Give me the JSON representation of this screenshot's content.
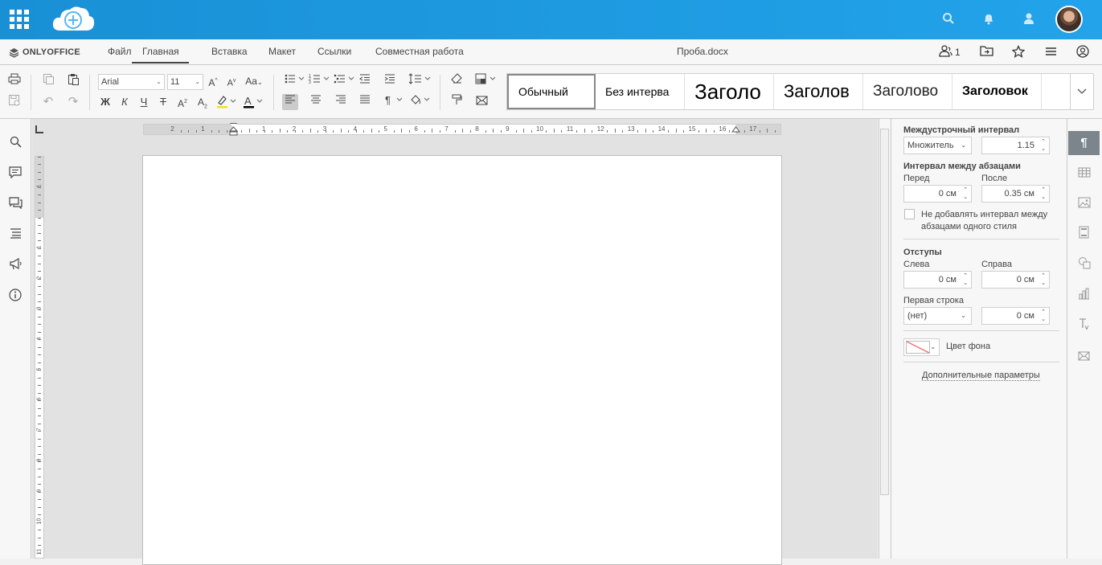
{
  "topbar": {
    "icons": [
      "apps-grid-icon",
      "cloud-logo",
      "search-icon",
      "bell-icon",
      "user-icon",
      "avatar"
    ]
  },
  "menubar": {
    "brand": "ONLYOFFICE",
    "tabs": [
      "Файл",
      "Главная",
      "Вставка",
      "Макет",
      "Ссылки",
      "Совместная работа"
    ],
    "active_tab": "Главная",
    "doc_title": "Проба.docx",
    "users_count": "1"
  },
  "toolbar": {
    "font_name": "Arial",
    "font_size": "11",
    "styles": [
      "Обычный",
      "Без интерва",
      "Заголо",
      "Заголов",
      "Заголово",
      "Заголовок"
    ]
  },
  "ruler": {
    "h_numbers": [
      "2",
      "1",
      "1",
      "2",
      "3",
      "4",
      "5",
      "6",
      "7",
      "8",
      "9",
      "10",
      "11",
      "12",
      "13",
      "14",
      "15",
      "16",
      "17"
    ],
    "v_numbers": [
      "1",
      "1",
      "2",
      "3",
      "4",
      "5",
      "6",
      "7",
      "8",
      "9",
      "10",
      "11"
    ]
  },
  "right_panel": {
    "line_spacing_label": "Междустрочный интервал",
    "line_spacing_mode": "Множитель",
    "line_spacing_value": "1.15",
    "para_spacing_label": "Интервал между абзацами",
    "before_label": "Перед",
    "after_label": "После",
    "before_value": "0 см",
    "after_value": "0.35 см",
    "no_spacing_label_1": "Не добавлять интервал между",
    "no_spacing_label_2": "абзацами одного стиля",
    "indents_label": "Отступы",
    "left_label": "Слева",
    "right_label": "Справа",
    "left_value": "0 см",
    "right_value": "0 см",
    "first_line_label": "Первая строка",
    "first_line_mode": "(нет)",
    "first_line_value": "0 см",
    "bg_color_label": "Цвет фона",
    "advanced_link": "Дополнительные параметры"
  }
}
